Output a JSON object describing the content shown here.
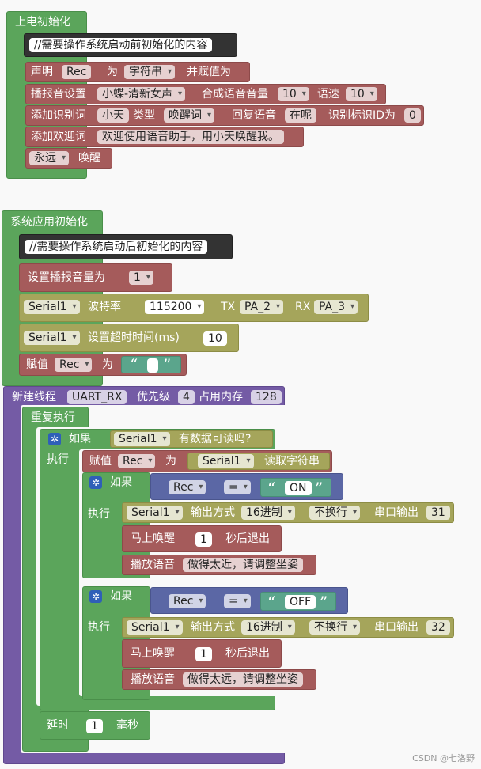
{
  "power_init": {
    "title": "上电初始化",
    "comment": "//需要操作系统启动前初始化的内容",
    "declare": {
      "label": "声明",
      "var": "Rec",
      "as": "为",
      "type": "字符串",
      "assign": "并赋值为"
    },
    "tts": {
      "label": "播报音设置",
      "voice": "小蝶-清新女声",
      "vol_label": "合成语音音量",
      "vol": "10",
      "speed_label": "语速",
      "speed": "10"
    },
    "add_cmd": {
      "label": "添加识别词",
      "word": "小天",
      "type_label": "类型",
      "type": "唤醒词",
      "reply_label": "回复语音",
      "reply": "在呢",
      "id_label": "识别标识ID为",
      "id": "0"
    },
    "welcome": {
      "label": "添加欢迎词",
      "text": "欢迎使用语音助手，用小天唤醒我。"
    },
    "wake": {
      "mode": "永远",
      "label": "唤醒"
    }
  },
  "app_init": {
    "title": "系统应用初始化",
    "comment": "//需要操作系统启动后初始化的内容",
    "volume": {
      "label": "设置播报音量为",
      "value": "1"
    },
    "serial": {
      "port": "Serial1",
      "baud_label": "波特率",
      "baud": "115200",
      "tx_label": "TX",
      "tx": "PA_2",
      "rx_label": "RX",
      "rx": "PA_3"
    },
    "timeout": {
      "port": "Serial1",
      "label": "设置超时时间(ms)",
      "value": "10"
    },
    "assign": {
      "label": "赋值",
      "var": "Rec",
      "as": "为",
      "open_q": "“",
      "close_q": "”"
    }
  },
  "thread": {
    "label": "新建线程",
    "name": "UART_RX",
    "prio_label": "优先级",
    "prio": "4",
    "mem_label": "占用内存",
    "mem": "128",
    "repeat": "重复执行",
    "if_label": "如果",
    "do_label": "执行",
    "cond_port": "Serial1",
    "cond_text": "有数据可读吗?",
    "assign": {
      "label": "赋值",
      "var": "Rec",
      "as": "为",
      "port": "Serial1",
      "read": "读取字符串"
    },
    "branch1": {
      "var": "Rec",
      "op": "=",
      "open_q": "“",
      "value": "ON",
      "close_q": "”",
      "out": {
        "port": "Serial1",
        "mode_label": "输出方式",
        "mode": "16进制",
        "nl": "不换行",
        "out_label": "串口输出",
        "value": "31"
      },
      "wake": {
        "label": "马上唤醒",
        "value": "1",
        "suffix": "秒后退出"
      },
      "speak": {
        "label": "播放语音",
        "text": "做得太近，请调整坐姿"
      }
    },
    "branch2": {
      "var": "Rec",
      "op": "=",
      "open_q": "“",
      "value": "OFF",
      "close_q": "”",
      "out": {
        "port": "Serial1",
        "mode_label": "输出方式",
        "mode": "16进制",
        "nl": "不换行",
        "out_label": "串口输出",
        "value": "32"
      },
      "wake": {
        "label": "马上唤醒",
        "value": "1",
        "suffix": "秒后退出"
      },
      "speak": {
        "label": "播放语音",
        "text": "做得太远，请调整坐姿"
      }
    },
    "delay": {
      "label": "延时",
      "value": "1",
      "unit": "毫秒"
    }
  },
  "credit": "CSDN @七洛野",
  "colors": {
    "logic": "#5ba55b",
    "var": "#a55b5b",
    "serial": "#a5a55b",
    "thread": "#745ba5",
    "compare": "#5b67a5",
    "text": "#5ba58c"
  }
}
